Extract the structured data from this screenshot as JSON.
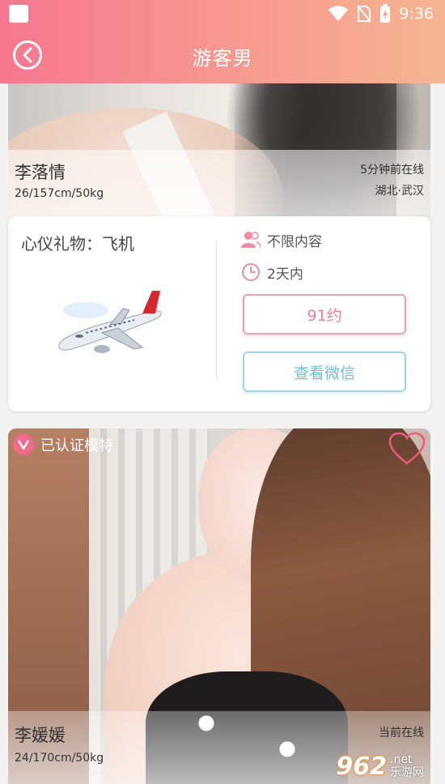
{
  "status_bar": {
    "time": "9:36"
  },
  "header": {
    "title": "游客男"
  },
  "profile1": {
    "name": "李落情",
    "stats": "26/157cm/50kg",
    "online": "5分钟前在线",
    "location": "湖北·武汉"
  },
  "gift_card": {
    "gift_label": "心仪礼物：飞机",
    "content_scope": "不限内容",
    "time_limit": "2天内",
    "book_button": "91约",
    "wechat_button": "查看微信"
  },
  "profile2": {
    "verified_label": "已认证模特",
    "name": "李媛媛",
    "stats": "24/170cm/50kg",
    "online": "当前在线"
  },
  "watermark": {
    "number": "962",
    "net": ".net",
    "site": "乐游网"
  },
  "colors": {
    "accent_pink": "#f6778f",
    "accent_peach": "#f6b592",
    "button_red": "#ee7f92",
    "button_blue": "#6fbfd4"
  }
}
